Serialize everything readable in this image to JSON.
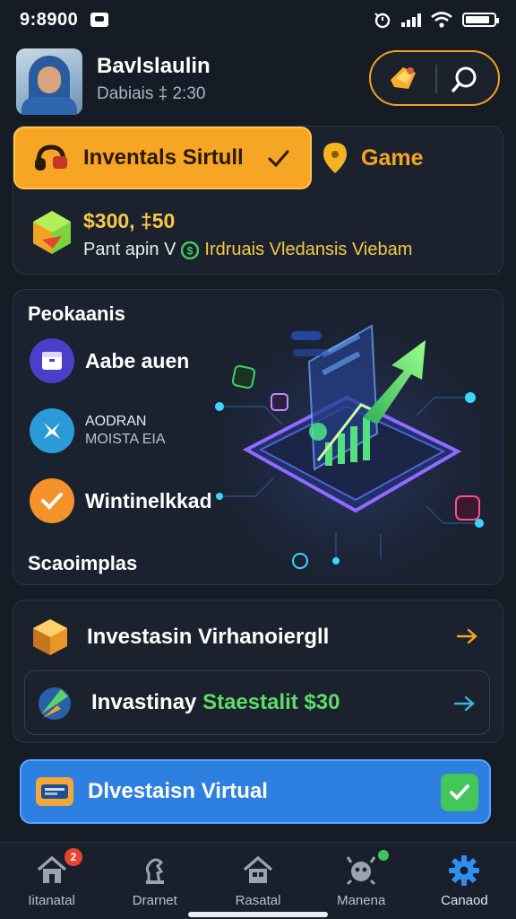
{
  "status_bar": {
    "time": "9:8900",
    "battery_level": 0.85
  },
  "profile": {
    "name": "Bavlslaulin",
    "subtitle": "Dabiais ‡ 2:30"
  },
  "top_card": {
    "sim_label": "Inventals Sirtull",
    "game_label": "Game",
    "amount": "$300, ‡50",
    "balance_left": "Pant apin V",
    "balance_right": "Irdruais Vledansis Viebam"
  },
  "feature_card": {
    "title": "Peokaanis",
    "items": [
      {
        "label": "Aabe auen",
        "icon": "box-icon",
        "color": "#4b3fc9"
      },
      {
        "label_line1": "AODRAN",
        "label_line2": "MOISTA EIA",
        "icon": "star-icon",
        "color": "#2a9bd7"
      },
      {
        "label": "Wintinelkkad",
        "icon": "check-icon",
        "color": "#f5922a"
      }
    ],
    "footer": "Scaoimplas"
  },
  "list_card": {
    "row1_label": "Investasin Virhanoiergll",
    "row2_label_a": "Invastinay",
    "row2_label_b": "Staestalit $30"
  },
  "cta": {
    "label": "Dlvestaisn Virtual"
  },
  "bottom_nav": [
    {
      "label": "Iitanatal",
      "icon": "home-icon",
      "badge": "2"
    },
    {
      "label": "Drarnet",
      "icon": "chess-icon"
    },
    {
      "label": "Rasatal",
      "icon": "house-icon"
    },
    {
      "label": "Manena",
      "icon": "robot-icon"
    },
    {
      "label": "Canaod",
      "icon": "gear-icon"
    }
  ],
  "colors": {
    "background": "#161c26",
    "accent_orange": "#f6a524",
    "accent_blue": "#2d7fe0",
    "accent_green": "#43c65a"
  }
}
